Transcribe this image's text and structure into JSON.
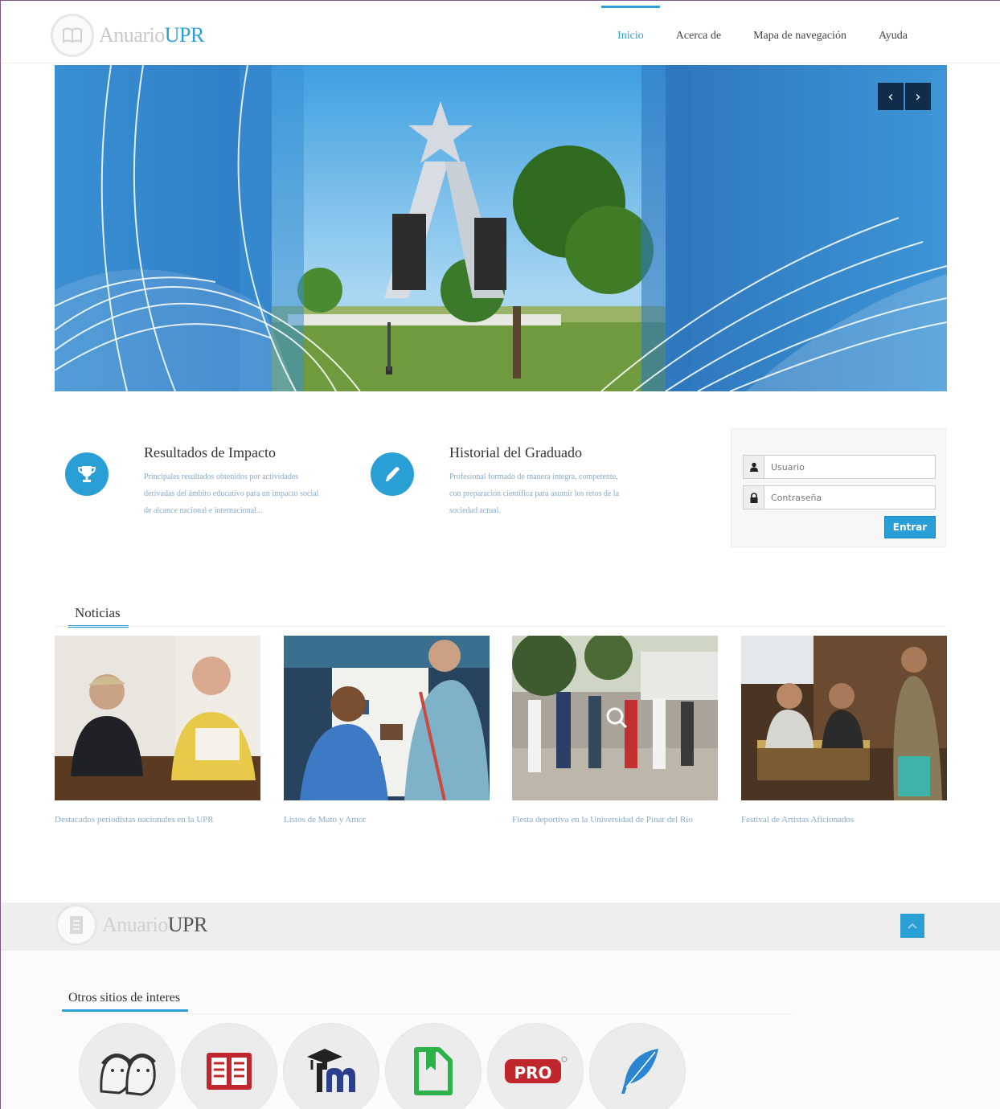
{
  "brand": {
    "name_light": "Anuario",
    "name_bold": "UPR"
  },
  "nav": [
    {
      "label": "Inicio",
      "active": true
    },
    {
      "label": "Acerca de",
      "active": false
    },
    {
      "label": "Mapa de navegación",
      "active": false
    },
    {
      "label": "Ayuda",
      "active": false
    }
  ],
  "slider": {
    "prev": "‹",
    "next": "›"
  },
  "features": [
    {
      "title": "Resultados de Impacto",
      "text": "Principales resultados obtenidos por actividades derivadas del ámbito educativo para un impacto social de alcance nacional e internacional..."
    },
    {
      "title": "Historial del Graduado",
      "text": "Profesional formado de manera íntegra, competente, con preparación científica para asumir los retos de la sociedad actual."
    }
  ],
  "login": {
    "user_placeholder": "Usuario",
    "pass_placeholder": "Contraseña",
    "submit": "Entrar"
  },
  "news": {
    "title": "Noticias",
    "items": [
      {
        "caption": "Destacados periodistas nacionales en la UPR"
      },
      {
        "caption": "Listos de Mato y Amor"
      },
      {
        "caption": "Fiesta deportiva en la Universidad de Pinar del Río"
      },
      {
        "caption": "Festival de Artistas Aficionados"
      }
    ]
  },
  "footer": {
    "brand_light": "Anuario",
    "brand_bold": "UPR",
    "sites_title": "Otros sitios de interes",
    "pro_label": "PRO"
  },
  "colors": {
    "accent": "#2a9fd6",
    "slider_dark": "#0f2d4a"
  }
}
